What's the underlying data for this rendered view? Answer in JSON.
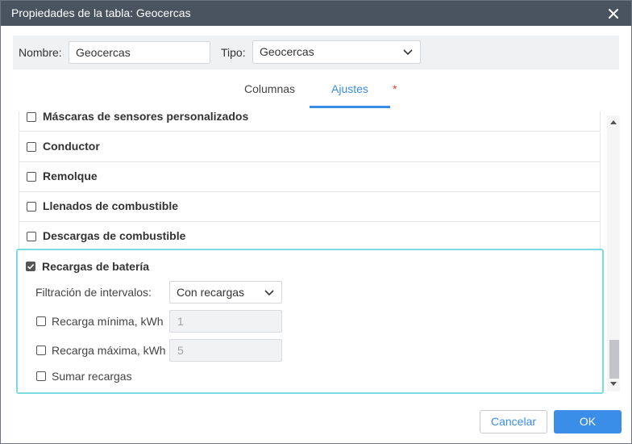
{
  "dialog": {
    "title": "Propiedades de la tabla: Geocercas"
  },
  "header": {
    "name_label": "Nombre:",
    "name_value": "Geocercas",
    "type_label": "Tipo:",
    "type_value": "Geocercas"
  },
  "tabs": [
    {
      "label": "Columnas",
      "active": false
    },
    {
      "label": "Ajustes",
      "active": true
    }
  ],
  "tab_required_marker": "*",
  "list": {
    "items": [
      {
        "label": "Máscaras de sensores personalizados",
        "checked": false
      },
      {
        "label": "Conductor",
        "checked": false
      },
      {
        "label": "Remolque",
        "checked": false
      },
      {
        "label": "Llenados de combustible",
        "checked": false
      },
      {
        "label": "Descargas de combustible",
        "checked": false
      }
    ],
    "expanded": {
      "label": "Recargas de batería",
      "checked": true,
      "filter_label": "Filtración de intervalos:",
      "filter_value": "Con recargas",
      "min_label": "Recarga mínima, kWh",
      "min_value": "1",
      "min_checked": false,
      "max_label": "Recarga máxima, kWh",
      "max_value": "5",
      "max_checked": false,
      "sum_label": "Sumar recargas",
      "sum_checked": false
    }
  },
  "footer": {
    "cancel_label": "Cancelar",
    "ok_label": "OK"
  },
  "colors": {
    "titlebar": "#4a5360",
    "accent": "#3b8ee8",
    "highlight_border": "#7ddbe5",
    "required": "#e53935"
  }
}
